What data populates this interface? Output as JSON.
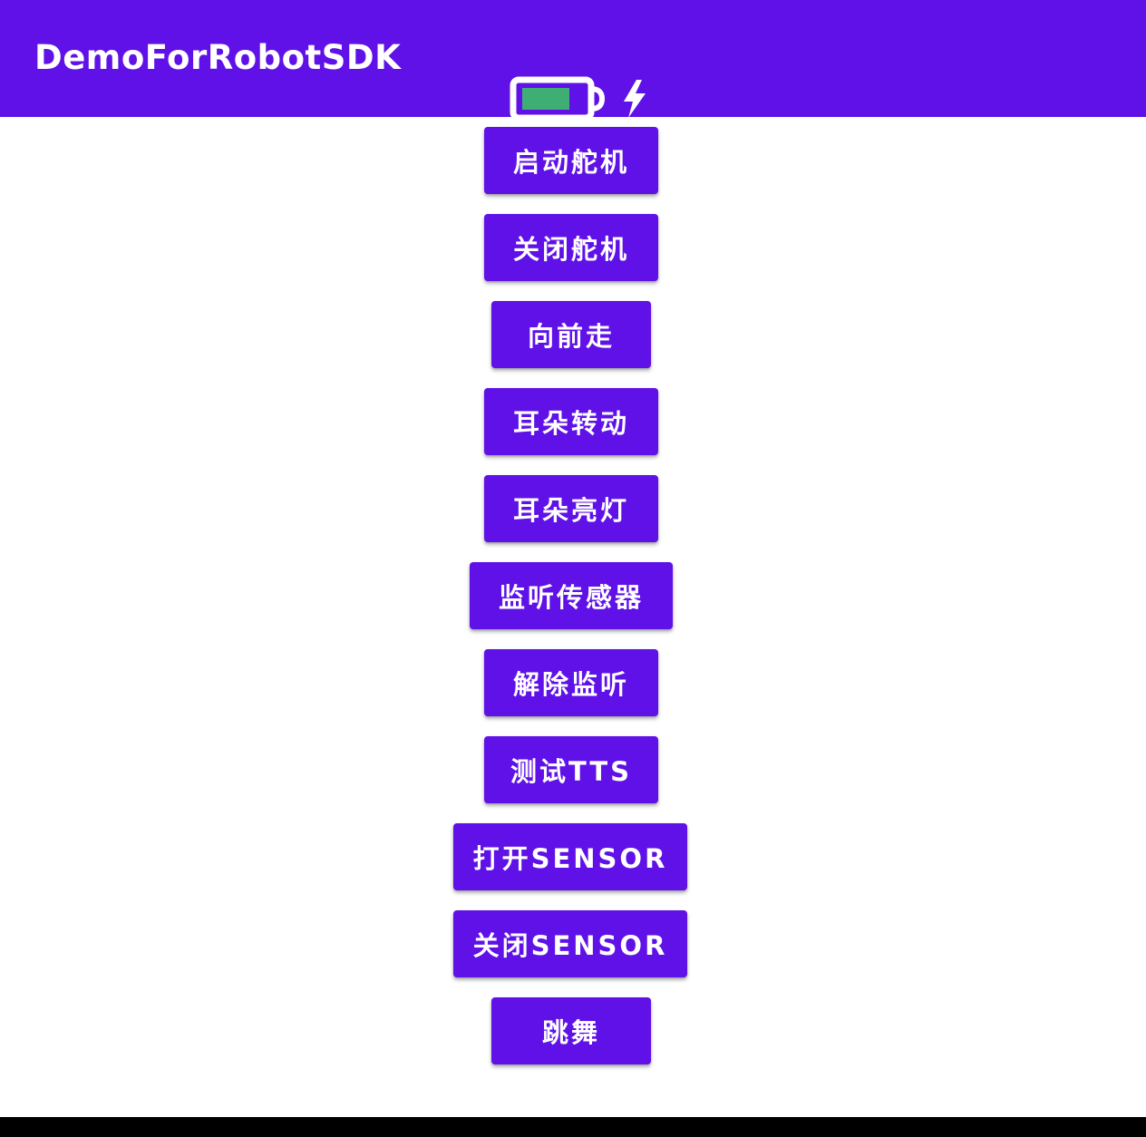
{
  "app_bar": {
    "title": "DemoForRobotSDK",
    "color": "#5f11e8",
    "icons": [
      "battery-icon",
      "charging-bolt-icon"
    ],
    "battery_fill_color": "#3fae74"
  },
  "buttons": [
    {
      "label": "启动舵机"
    },
    {
      "label": "关闭舵机"
    },
    {
      "label": "向前走"
    },
    {
      "label": "耳朵转动"
    },
    {
      "label": "耳朵亮灯"
    },
    {
      "label": "监听传感器"
    },
    {
      "label": "解除监听"
    },
    {
      "label": "测试TTS"
    },
    {
      "label": "打开SENSOR"
    },
    {
      "label": "关闭SENSOR"
    },
    {
      "label": "跳舞"
    }
  ],
  "button_color": "#5f11e8"
}
